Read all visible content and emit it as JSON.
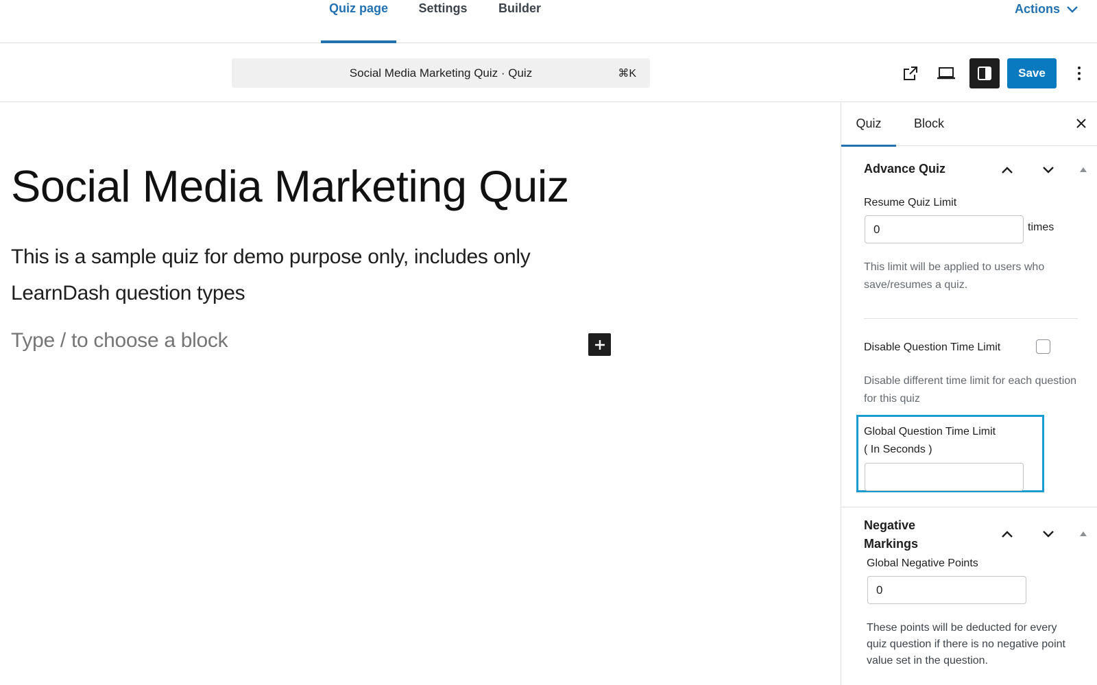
{
  "top_tabs": [
    {
      "label": "Quiz page",
      "active": true
    },
    {
      "label": "Settings",
      "active": false
    },
    {
      "label": "Builder",
      "active": false
    }
  ],
  "actions_label": "Actions",
  "command_bar": {
    "text": "Social Media Marketing Quiz · Quiz",
    "shortcut": "⌘K"
  },
  "header_icons": [
    "external-link-icon",
    "desktop-preview-icon",
    "sidebar-toggle-icon",
    "more-vertical-icon"
  ],
  "save_label": "Save",
  "content": {
    "title": "Social Media Marketing Quiz",
    "paragraph": "This is a sample quiz for demo purpose only, includes only LearnDash question types",
    "block_placeholder": "Type / to choose a block"
  },
  "sidebar": {
    "tabs": [
      {
        "label": "Quiz",
        "active": true
      },
      {
        "label": "Block",
        "active": false
      }
    ],
    "advance_quiz": {
      "title": "Advance Quiz",
      "resume_label": "Resume Quiz Limit",
      "resume_value": "0",
      "resume_suffix": "times",
      "resume_help": "This limit will be applied to users who save/resumes a quiz.",
      "disable_time_label": "Disable Question Time Limit",
      "disable_time_checked": false,
      "disable_time_help": "Disable different time limit for each question for this quiz",
      "global_time_label_1": "Global Question Time Limit",
      "global_time_label_2": "( In Seconds )",
      "global_time_value": ""
    },
    "negative_markings": {
      "title_1": "Negative",
      "title_2": "Markings",
      "points_label": "Global Negative Points",
      "points_value": "0",
      "points_help": "These points will be deducted for every quiz question if there is no negative point value set in the question."
    }
  },
  "colors": {
    "accent": "#2271b1",
    "save_button": "#0a7ac0",
    "highlight_border": "#1a9bd0"
  }
}
